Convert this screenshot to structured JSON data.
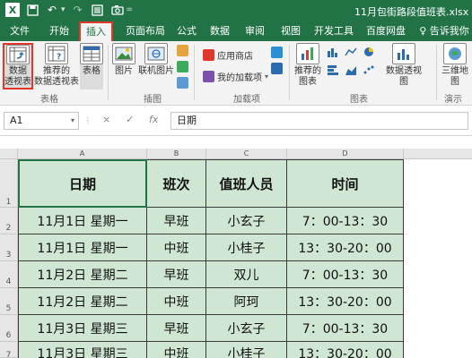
{
  "window": {
    "title": "11月包街路段值班表.xlsx",
    "undo_icon": "undo-icon",
    "redo_icon": "redo-icon",
    "save_icon": "save-icon"
  },
  "tabs": [
    "文件",
    "开始",
    "插入",
    "页面布局",
    "公式",
    "数据",
    "审阅",
    "视图",
    "开发工具",
    "百度网盘",
    "告诉我你"
  ],
  "active_tab": "插入",
  "ribbon": {
    "pivot_table": "数据\n透视表",
    "recommended_pivot": "推荐的\n数据透视表",
    "table": "表格",
    "picture": "图片",
    "online_picture": "联机图片",
    "app_store": "应用商店",
    "my_addins": "我的加载项",
    "recommended_charts": "推荐的\n图表",
    "pivot_chart": "数据透视图",
    "map_3d": "三维地\n图",
    "group_tables": "表格",
    "group_illustrations": "插图",
    "group_addins": "加载项",
    "group_charts": "图表",
    "group_tours": "演示",
    "colors": {
      "title_bar": "#217346",
      "active_tab_border": "#e0382b",
      "cell_fill": "#cfe6d2"
    }
  },
  "formula_bar": {
    "name_box": "A1",
    "cancel_icon": "×",
    "enter_icon": "✓",
    "fx_label": "fx",
    "value": "日期"
  },
  "columns": [
    "A",
    "B",
    "C",
    "D"
  ],
  "rows": [
    "1",
    "2",
    "3",
    "4",
    "5",
    "6",
    "7"
  ],
  "table": {
    "headers": [
      "日期",
      "班次",
      "值班人员",
      "时间"
    ],
    "rows": [
      [
        "11月1日  星期一",
        "早班",
        "小玄子",
        "7：00-13：30"
      ],
      [
        "11月1日  星期一",
        "中班",
        "小桂子",
        "13：30-20：00"
      ],
      [
        "11月2日  星期二",
        "早班",
        "双儿",
        "7：00-13：30"
      ],
      [
        "11月2日  星期二",
        "中班",
        "阿珂",
        "13：30-20：00"
      ],
      [
        "11月3日  星期三",
        "早班",
        "小玄子",
        "7：00-13：30"
      ],
      [
        "11月3日  星期三",
        "中班",
        "小桂子",
        "13：30-20：00"
      ]
    ]
  }
}
